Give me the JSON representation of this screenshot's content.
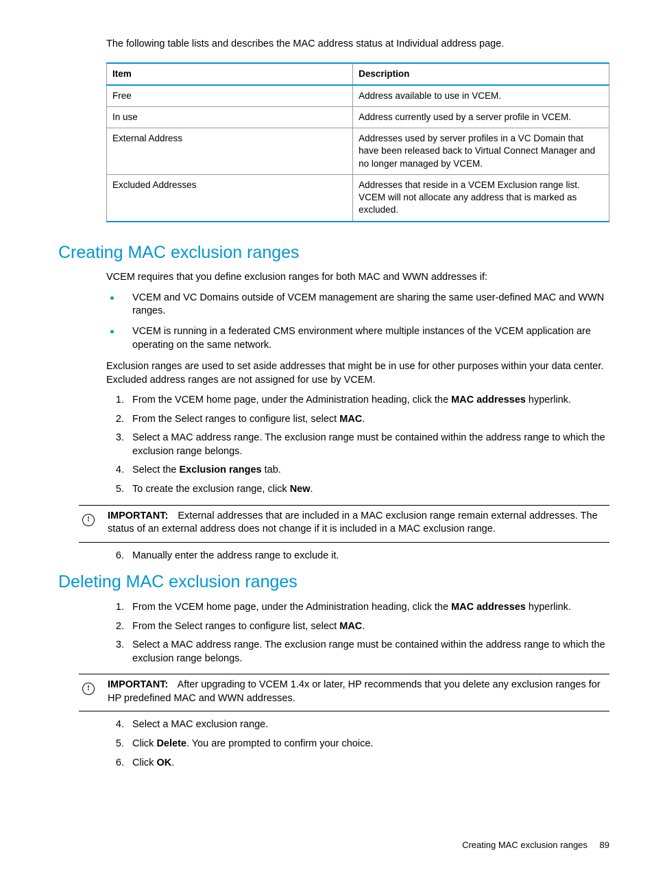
{
  "intro": "The following table lists and describes the MAC address status at Individual address page.",
  "table": {
    "headers": {
      "c1": "Item",
      "c2": "Description"
    },
    "rows": [
      {
        "item": "Free",
        "desc": "Address available to use in VCEM."
      },
      {
        "item": "In use",
        "desc": "Address currently used by a server profile in VCEM."
      },
      {
        "item": "External Address",
        "desc": "Addresses used by server profiles in a VC Domain that have been released back to Virtual Connect Manager and no longer managed by VCEM."
      },
      {
        "item": "Excluded Addresses",
        "desc": "Addresses that reside in a VCEM Exclusion range list. VCEM will not allocate any address that is marked as excluded."
      }
    ]
  },
  "sectionA": {
    "title": "Creating MAC exclusion ranges",
    "lead": "VCEM requires that you define exclusion ranges for both MAC and WWN addresses if:",
    "bullets": [
      "VCEM and VC Domains outside of VCEM management are sharing the same user-defined MAC and WWN ranges.",
      "VCEM is running in a federated CMS environment where multiple instances of the VCEM application are operating on the same network."
    ],
    "para2": "Exclusion ranges are used to set aside addresses that might be in use for other purposes within your data center. Excluded address ranges are not assigned for use by VCEM.",
    "steps_a": {
      "s1a": "From the VCEM home page, under the Administration heading, click the ",
      "s1b": "MAC addresses",
      "s1c": " hyperlink.",
      "s2a": "From the Select ranges to configure list, select ",
      "s2b": "MAC",
      "s2c": ".",
      "s3": "Select a MAC address range. The exclusion range must be contained within the address range to which the exclusion range belongs.",
      "s4a": "Select the ",
      "s4b": "Exclusion ranges",
      "s4c": " tab.",
      "s5a": "To create the exclusion range, click ",
      "s5b": "New",
      "s5c": "."
    },
    "important": {
      "label": "IMPORTANT:",
      "text": "External addresses that are included in a MAC exclusion range remain external addresses. The status of an external address does not change if it is included in a MAC exclusion range."
    },
    "steps_b": {
      "s6": "Manually enter the address range to exclude it."
    }
  },
  "sectionB": {
    "title": "Deleting MAC exclusion ranges",
    "steps_a": {
      "s1a": "From the VCEM home page, under the Administration heading, click the ",
      "s1b": "MAC addresses",
      "s1c": " hyperlink.",
      "s2a": "From the Select ranges to configure list, select ",
      "s2b": "MAC",
      "s2c": ".",
      "s3": "Select a MAC address range. The exclusion range must be contained within the address range to which the exclusion range belongs."
    },
    "important": {
      "label": "IMPORTANT:",
      "text": "After upgrading to VCEM 1.4x or later, HP recommends that you delete any exclusion ranges for HP predefined MAC and WWN addresses."
    },
    "steps_b": {
      "s4": "Select a MAC exclusion range.",
      "s5a": "Click ",
      "s5b": "Delete",
      "s5c": ". You are prompted to confirm your choice.",
      "s6a": "Click ",
      "s6b": "OK",
      "s6c": "."
    }
  },
  "footer": {
    "text": "Creating MAC exclusion ranges",
    "page": "89"
  },
  "nums": {
    "n1": "1.",
    "n2": "2.",
    "n3": "3.",
    "n4": "4.",
    "n5": "5.",
    "n6": "6."
  }
}
